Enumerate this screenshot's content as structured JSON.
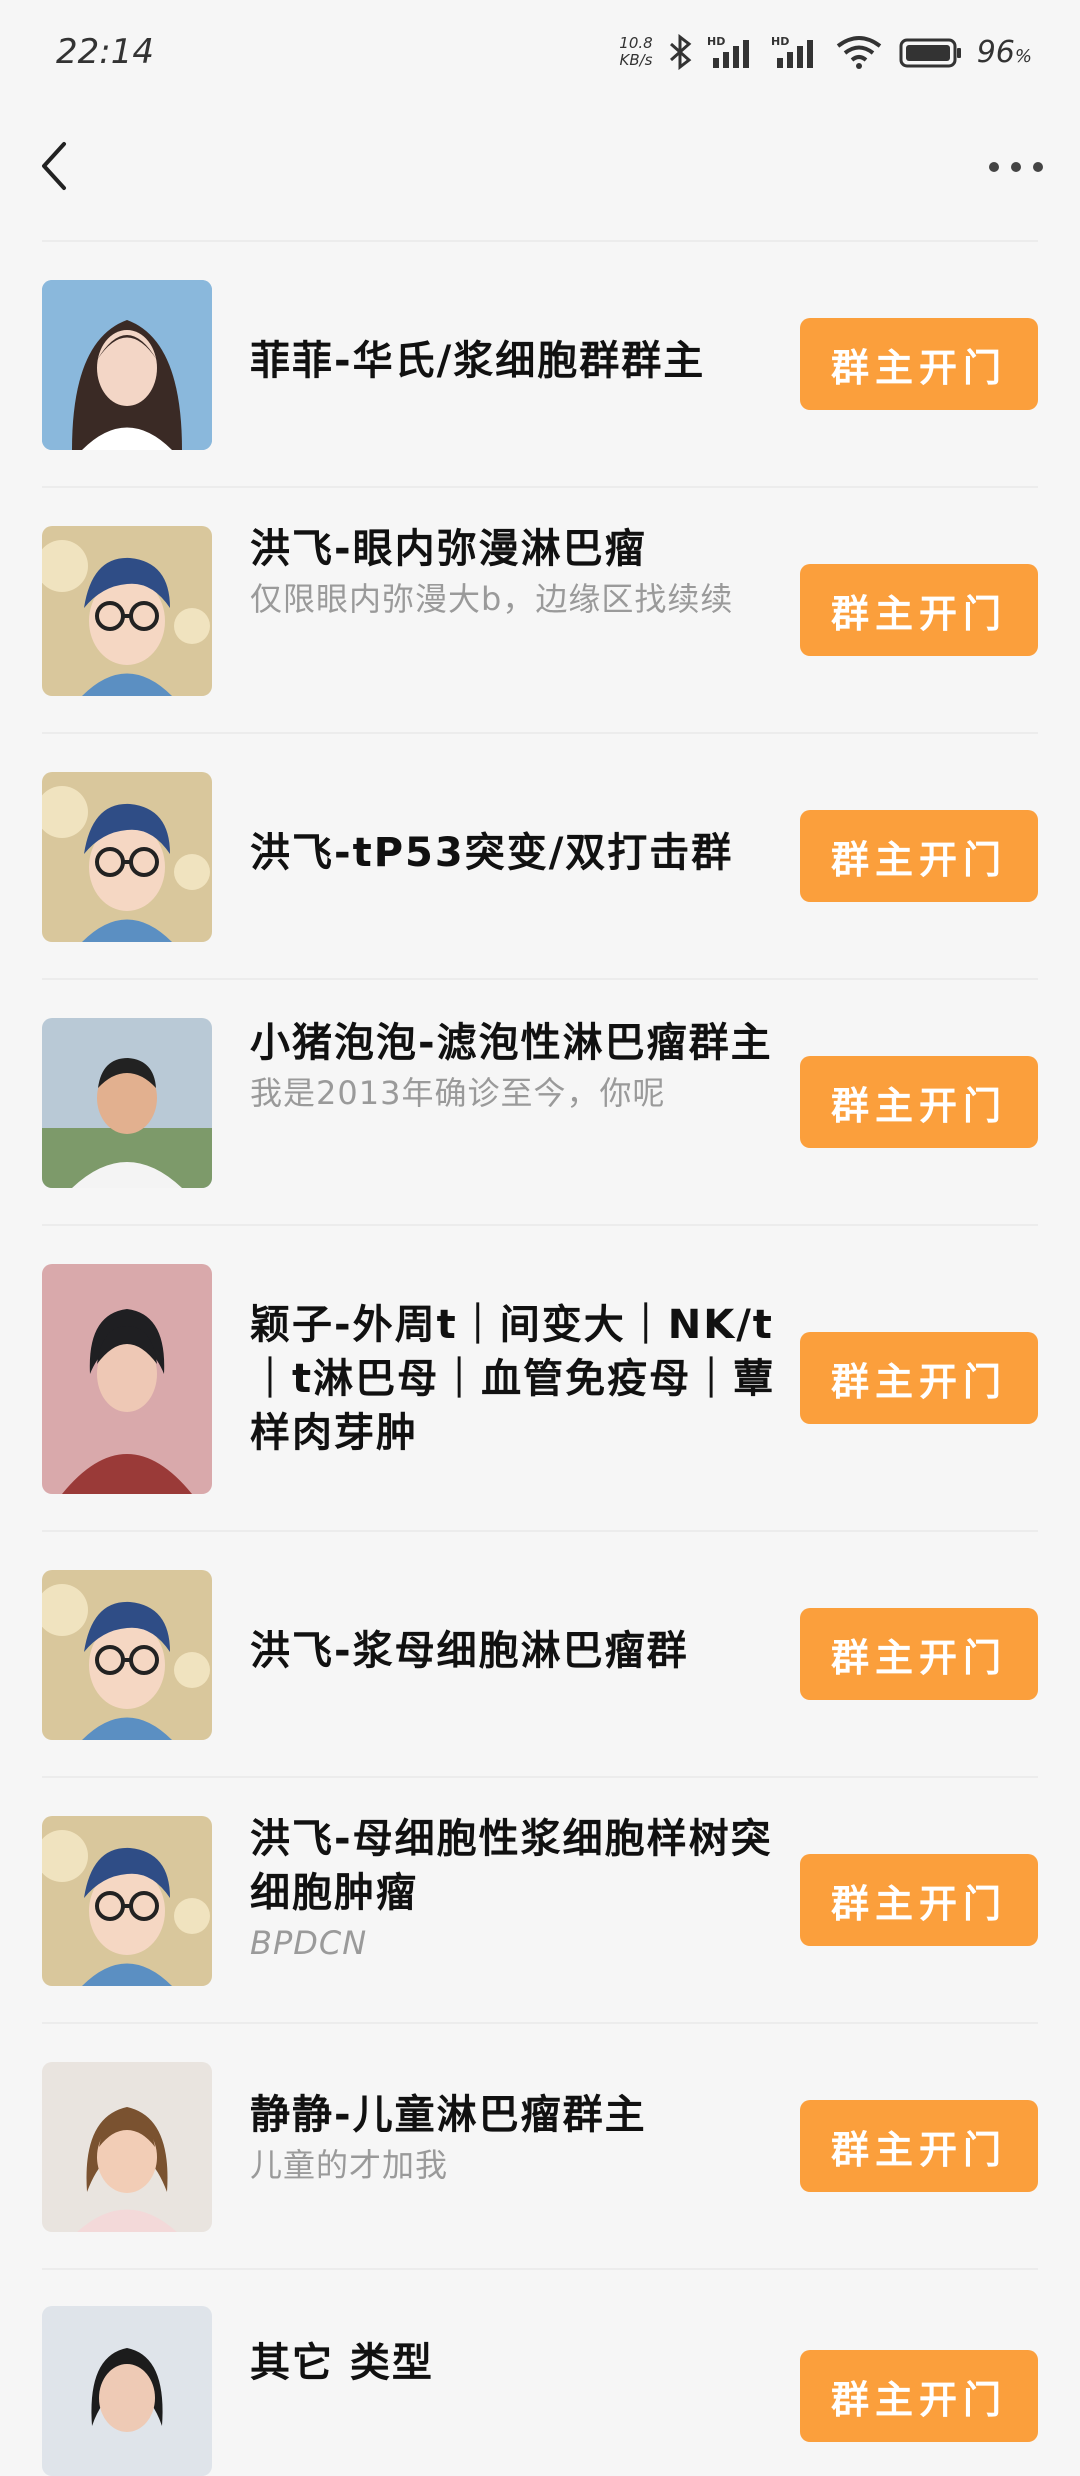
{
  "status_bar": {
    "time": "22:14",
    "net_speed_value": "10.8",
    "net_speed_unit": "KB/s",
    "battery_percent": "96"
  },
  "nav": {
    "back_icon": "back-arrow-icon",
    "more_icon": "more-dots-icon"
  },
  "button_label": "群主开门",
  "colors": {
    "accent": "#fb9f3c",
    "background": "#f6f6f6"
  },
  "groups": [
    {
      "title": "菲菲-华氏/浆细胞群群主",
      "subtitle": ""
    },
    {
      "title": "洪飞-眼内弥漫淋巴瘤",
      "subtitle": "仅限眼内弥漫大b，边缘区找续续"
    },
    {
      "title": "洪飞-tP53突变/双打击群",
      "subtitle": ""
    },
    {
      "title": "小猪泡泡-滤泡性淋巴瘤群主",
      "subtitle": "我是2013年确诊至今，你呢"
    },
    {
      "title": "颖子-外周t｜间变大｜NK/t｜t淋巴母｜血管免疫母｜蕈样肉芽肿",
      "subtitle": ""
    },
    {
      "title": "洪飞-浆母细胞淋巴瘤群",
      "subtitle": ""
    },
    {
      "title": "洪飞-母细胞性浆细胞样树突细胞肿瘤",
      "subtitle": "BPDCN"
    },
    {
      "title": "静静-儿童淋巴瘤群主",
      "subtitle": "儿童的才加我"
    },
    {
      "title": "其它 类型",
      "subtitle": ""
    }
  ]
}
